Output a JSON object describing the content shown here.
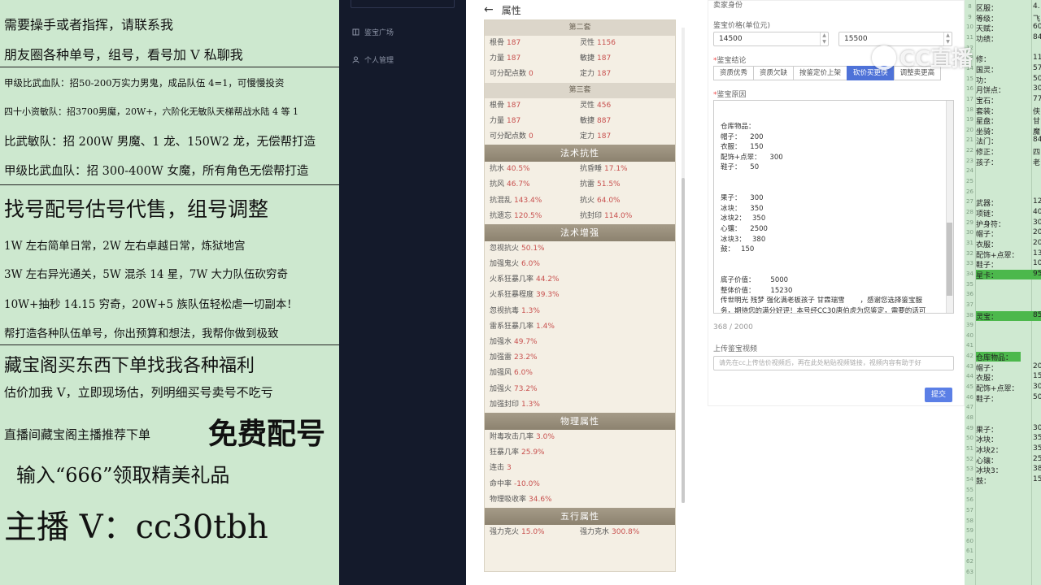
{
  "promo": {
    "lines": [
      "需要操手或者指挥，请联系我",
      "朋友圈各种单号，组号，看号加 V 私聊我",
      "甲级比武血队：招50-200万实力男鬼，成品队伍 4=1，可慢慢投资",
      "四十小资敏队：招3700男魔，20W+，六阶化无敏队天梯帮战水陆 4 等 1",
      "比武敏队：招 200W 男魔、1 龙、150W2 龙，无偿帮打造",
      "甲级比武血队：招 300-400W 女魔，所有角色无偿帮打造",
      "找号配号估号代售，组号调整",
      "1W 左右简单日常，2W 左右卓越日常，炼狱地宫",
      "3W 左右异光通关，5W 混杀 14 星，7W 大力队伍砍穷奇",
      "10W+抽秒 14.15 穷奇，20W+5 族队伍轻松虐一切副本！",
      "帮打造各种队伍单号，你出预算和想法，我帮你做到极致",
      "藏宝阁买东西下单找我各种福利",
      "估价加我 V，立即现场估，列明细买号卖号不吃亏",
      "直播间藏宝阁主播推荐下单",
      "免费配号",
      "输入“666”领取精美礼品",
      "主播 V：cc30tbh"
    ]
  },
  "nav": {
    "items": [
      {
        "icon": "book-icon",
        "label": "鉴宝广场"
      },
      {
        "icon": "user-icon",
        "label": "个人管理"
      }
    ]
  },
  "attr": {
    "back": "←",
    "title": "属性",
    "set2_title": "第二套",
    "set2": [
      [
        "根骨",
        "187",
        "灵性",
        "1156"
      ],
      [
        "力量",
        "187",
        "敏捷",
        "187"
      ],
      [
        "可分配点数",
        "0",
        "定力",
        "187"
      ]
    ],
    "set3_title": "第三套",
    "set3": [
      [
        "根骨",
        "187",
        "灵性",
        "456"
      ],
      [
        "力量",
        "187",
        "敏捷",
        "887"
      ],
      [
        "可分配点数",
        "0",
        "定力",
        "187"
      ]
    ],
    "resist_title": "法术抗性",
    "resist": [
      [
        "抗水",
        "40.5%",
        "抗昏睡",
        "17.1%"
      ],
      [
        "抗风",
        "46.7%",
        "抗雷",
        "51.5%"
      ],
      [
        "抗混乱",
        "143.4%",
        "抗火",
        "64.0%"
      ],
      [
        "抗遗忘",
        "120.5%",
        "抗封印",
        "114.0%"
      ]
    ],
    "boost_title": "法术增强",
    "boost": [
      [
        "忽视抗火",
        "50.1%"
      ],
      [
        "加强鬼火",
        "6.0%"
      ],
      [
        "火系狂暴几率",
        "44.2%"
      ],
      [
        "火系狂暴程度",
        "39.3%"
      ],
      [
        "忽视抗毒",
        "1.3%"
      ],
      [
        "雷系狂暴几率",
        "1.4%"
      ],
      [
        "加强水",
        "49.7%"
      ],
      [
        "加强雷",
        "23.2%"
      ],
      [
        "加强风",
        "6.0%"
      ],
      [
        "加强火",
        "73.2%"
      ],
      [
        "加强封印",
        "1.3%"
      ]
    ],
    "phys_title": "物理属性",
    "phys": [
      [
        "附毒攻击几率",
        "3.0%"
      ],
      [
        "狂暴几率",
        "25.9%"
      ],
      [
        "连击",
        "3"
      ],
      [
        "命中率",
        "-10.0%"
      ],
      [
        "物理吸收率",
        "34.6%"
      ]
    ],
    "five_title": "五行属性",
    "five_partial": [
      "强力克火",
      "15.0%",
      "强力克水",
      "300.8%"
    ]
  },
  "form": {
    "top_label": "卖家身份",
    "price_label": "鉴宝价格(单位元)",
    "price_low": "14500",
    "price_high": "15500",
    "conclusion_label": "鉴宝结论",
    "tabs": [
      "资质优秀",
      "资质欠缺",
      "按鉴定价上架",
      "砍价买更快",
      "调整卖更高"
    ],
    "active_tab": 3,
    "reason_label": "鉴宝原因",
    "reason_text": "仓库物品：\n帽子：    200\n衣服：    150\n配饰+点翠：    300\n鞋子：    50\n\n\n果子：    300\n冰块：    350\n冰块2：   350\n心镶：    2500\n冰块3：   380\n鼓：   150\n\n\n底子价值：       5000\n整体价值：       15230\n传世明光 残梦 强化满老板孩子 甘霖瑞雪       ，感谢您选择鉴宝服\n务，期待您的满分好评！本号经CC30唐伯虎为您鉴定，需要的话可\n以联系主播进行交易",
    "counter": "368 / 2000",
    "video_label": "上传鉴宝视频",
    "video_placeholder": "请先在cc上传估价视频后，再在此处粘贴视频链接，视频内容有助于好",
    "submit": "提交"
  },
  "sheet": {
    "rows": [
      [
        "8",
        "区服：",
        "4."
      ],
      [
        "9",
        "等级：",
        "飞"
      ],
      [
        "10",
        "天赋：",
        "60"
      ],
      [
        "11",
        "功绩：",
        "84"
      ],
      [
        "12",
        "",
        ""
      ],
      [
        "13",
        "修：",
        "11"
      ],
      [
        "14",
        "国灵：",
        "57"
      ],
      [
        "15",
        "功：",
        "50"
      ],
      [
        "16",
        "月饼点：",
        "30"
      ],
      [
        "17",
        "宝石：",
        "77"
      ],
      [
        "18",
        "套装：",
        "侠"
      ],
      [
        "19",
        "星盘：",
        "甘"
      ],
      [
        "20",
        "坐骑：",
        "魔"
      ],
      [
        "21",
        "法门：",
        "84"
      ],
      [
        "22",
        "修正：",
        "四"
      ],
      [
        "23",
        "孩子：",
        "老"
      ],
      [
        "24",
        "",
        ""
      ],
      [
        "25",
        "",
        ""
      ],
      [
        "26",
        "",
        ""
      ],
      [
        "27",
        "武器：",
        "12"
      ],
      [
        "28",
        "项链：",
        "40"
      ],
      [
        "29",
        "护身符：",
        "30"
      ],
      [
        "30",
        "帽子：",
        "20"
      ],
      [
        "31",
        "衣服：",
        "20"
      ],
      [
        "32",
        "配饰+点翠：",
        "13"
      ],
      [
        "33",
        "鞋子：",
        "10"
      ],
      [
        "34",
        "星卡：",
        "95"
      ],
      [
        "35",
        "",
        ""
      ],
      [
        "36",
        "",
        ""
      ],
      [
        "37",
        "",
        ""
      ],
      [
        "38",
        "灵宝：",
        "85"
      ],
      [
        "39",
        "",
        ""
      ],
      [
        "40",
        "",
        ""
      ],
      [
        "41",
        "",
        ""
      ],
      [
        "42",
        "仓库物品：",
        ""
      ],
      [
        "43",
        "帽子：",
        "20"
      ],
      [
        "44",
        "衣服：",
        "15"
      ],
      [
        "45",
        "配饰+点翠：",
        "30"
      ],
      [
        "46",
        "鞋子：",
        "50"
      ],
      [
        "47",
        "",
        ""
      ],
      [
        "48",
        "",
        ""
      ],
      [
        "49",
        "果子：",
        "30"
      ],
      [
        "50",
        "冰块：",
        "35"
      ],
      [
        "51",
        "冰块2：",
        "35"
      ],
      [
        "52",
        "心镶：",
        "25"
      ],
      [
        "53",
        "冰块3：",
        "38"
      ],
      [
        "54",
        "鼓：",
        "15"
      ],
      [
        "55",
        "",
        ""
      ],
      [
        "56",
        "",
        ""
      ],
      [
        "57",
        "",
        ""
      ],
      [
        "58",
        "",
        ""
      ],
      [
        "59",
        "",
        ""
      ],
      [
        "60",
        "",
        ""
      ],
      [
        "61",
        "",
        ""
      ],
      [
        "62",
        "",
        ""
      ],
      [
        "63",
        "",
        ""
      ]
    ]
  },
  "watermark": "CC直播"
}
